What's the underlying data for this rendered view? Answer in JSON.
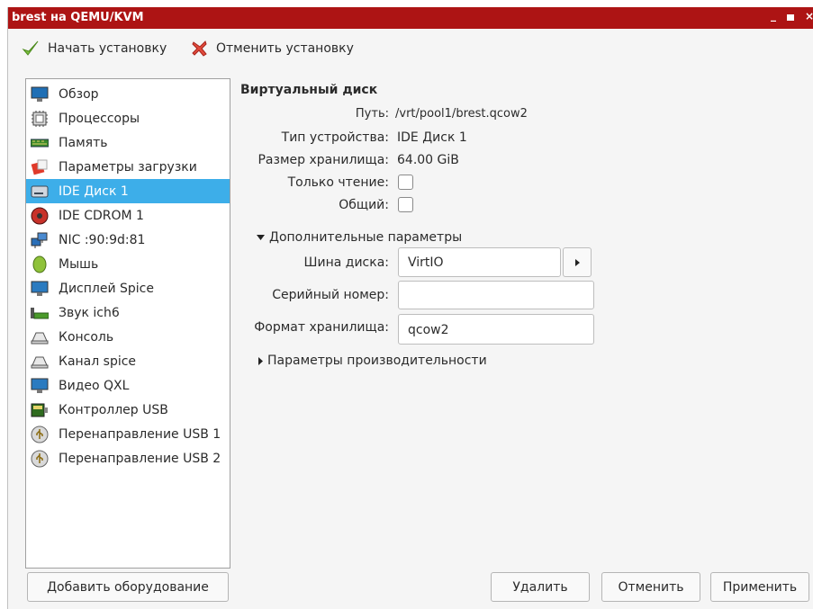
{
  "window": {
    "title": "brest на QEMU/KVM"
  },
  "toolbar": {
    "start_install": "Начать установку",
    "cancel_install": "Отменить установку"
  },
  "sidebar": {
    "items": [
      {
        "label": "Обзор",
        "icon": "monitor-icon"
      },
      {
        "label": "Процессоры",
        "icon": "cpu-icon"
      },
      {
        "label": "Память",
        "icon": "memory-icon"
      },
      {
        "label": "Параметры загрузки",
        "icon": "boot-options-icon"
      },
      {
        "label": "IDE Диск 1",
        "icon": "hard-disk-icon",
        "selected": true
      },
      {
        "label": "IDE CDROM 1",
        "icon": "cdrom-icon"
      },
      {
        "label": "NIC :90:9d:81",
        "icon": "network-icon"
      },
      {
        "label": "Мышь",
        "icon": "mouse-icon"
      },
      {
        "label": "Дисплей Spice",
        "icon": "display-icon"
      },
      {
        "label": "Звук ich6",
        "icon": "sound-card-icon"
      },
      {
        "label": "Консоль",
        "icon": "console-icon"
      },
      {
        "label": "Канал spice",
        "icon": "channel-icon"
      },
      {
        "label": "Видео QXL",
        "icon": "video-icon"
      },
      {
        "label": "Контроллер USB",
        "icon": "usb-controller-icon"
      },
      {
        "label": "Перенаправление USB 1",
        "icon": "usb-redirect-icon"
      },
      {
        "label": "Перенаправление USB 2",
        "icon": "usb-redirect-icon"
      }
    ],
    "add_hardware": "Добавить оборудование"
  },
  "details": {
    "heading": "Виртуальный диск",
    "path_label": "Путь:",
    "path_value": "/vrt/pool1/brest.qcow2",
    "device_type_label": "Тип устройства:",
    "device_type_value": "IDE Диск 1",
    "storage_size_label": "Размер хранилища:",
    "storage_size_value": "64.00 GiB",
    "readonly_label": "Только чтение:",
    "readonly_checked": false,
    "shared_label": "Общий:",
    "shared_checked": false,
    "advanced": {
      "label": "Дополнительные параметры",
      "expanded": true,
      "bus_label": "Шина диска:",
      "bus_value": "VirtIO",
      "serial_label": "Серийный номер:",
      "serial_value": "",
      "format_label": "Формат хранилища:",
      "format_value": "qcow2"
    },
    "performance": {
      "label": "Параметры производительности",
      "expanded": false
    }
  },
  "buttons": {
    "remove": "Удалить",
    "cancel": "Отменить",
    "apply": "Применить"
  },
  "colors": {
    "titlebar": "#ad1414",
    "selection": "#3daee9"
  }
}
